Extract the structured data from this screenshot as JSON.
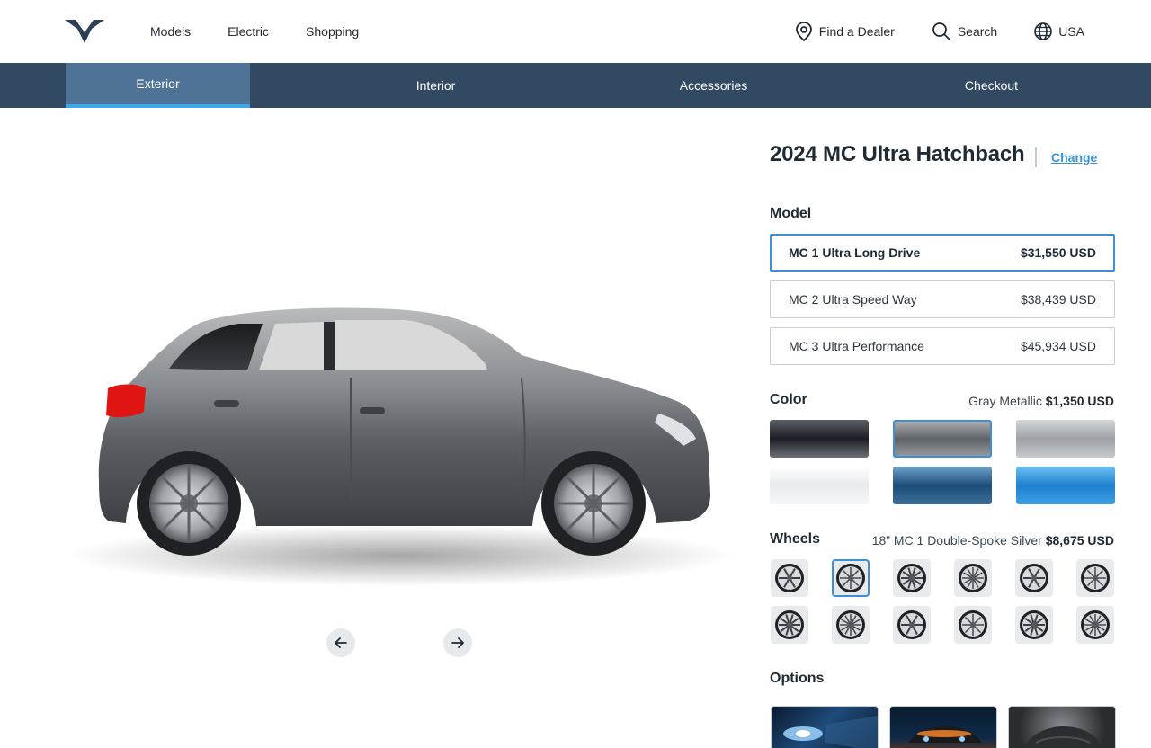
{
  "header": {
    "nav": [
      "Models",
      "Electric",
      "Shopping"
    ],
    "find_dealer": "Find a Dealer",
    "search": "Search",
    "region": "USA"
  },
  "tabs": [
    {
      "label": "Exterior",
      "active": true
    },
    {
      "label": "Interior",
      "active": false
    },
    {
      "label": "Accessories",
      "active": false
    },
    {
      "label": "Checkout",
      "active": false
    }
  ],
  "vehicle": {
    "title": "2024 MC Ultra Hatchbach",
    "change_label": "Change"
  },
  "model": {
    "label": "Model",
    "options": [
      {
        "name": "MC 1 Ultra Long Drive",
        "price": "$31,550 USD",
        "selected": true
      },
      {
        "name": "MC 2 Ultra Speed Way",
        "price": "$38,439 USD",
        "selected": false
      },
      {
        "name": "MC 3 Ultra Performance",
        "price": "$45,934 USD",
        "selected": false
      }
    ]
  },
  "color": {
    "label": "Color",
    "selected_name": "Gray Metallic",
    "selected_price": "$1,350 USD",
    "swatches": [
      {
        "name": "black",
        "top": "#5a5f66",
        "mid": "#1b1f24",
        "selected": false
      },
      {
        "name": "gray-metallic",
        "top": "#b3b5b8",
        "mid": "#5f6266",
        "selected": true
      },
      {
        "name": "silver",
        "top": "#d3d5d8",
        "mid": "#9da1a6",
        "selected": false
      },
      {
        "name": "white",
        "top": "#ffffff",
        "mid": "#e8eaec",
        "selected": false
      },
      {
        "name": "ocean-blue",
        "top": "#6ea2c9",
        "mid": "#1d4e7a",
        "selected": false
      },
      {
        "name": "sky-blue",
        "top": "#6ec0f3",
        "mid": "#1d7fcf",
        "selected": false
      }
    ]
  },
  "wheels": {
    "label": "Wheels",
    "selected_name": "18” MC 1 Double-Spoke Silver",
    "selected_price": "$8,675 USD",
    "count": 12,
    "selected_index": 1
  },
  "options": {
    "label": "Options",
    "thumbnails": [
      "headlight",
      "night-car",
      "car-cover"
    ]
  },
  "colors": {
    "accent": "#3d8fd6",
    "tab_bar": "#324a61",
    "tab_active": "#4f7397",
    "tab_indicator": "#3da5ea"
  }
}
